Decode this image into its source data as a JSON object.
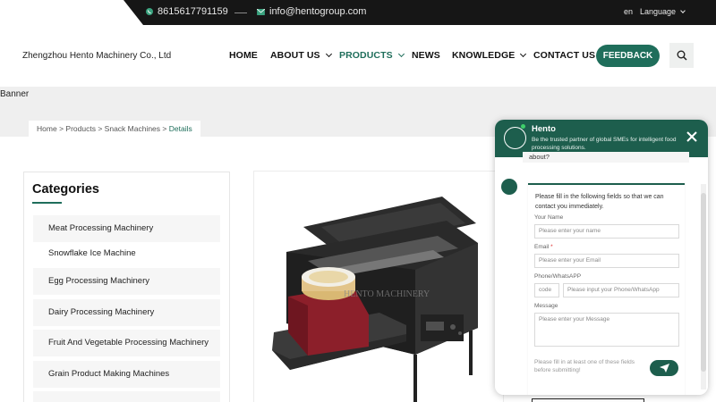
{
  "topbar": {
    "phone": "8615617791159",
    "email": "info@hentogroup.com",
    "lang_code": "en",
    "language_label": "Language"
  },
  "header": {
    "company": "Zhengzhou Hento Machinery Co., Ltd",
    "nav": {
      "home": "HOME",
      "about": "ABOUT US",
      "products": "PRODUCTS",
      "news": "NEWS",
      "knowledge": "KNOWLEDGE",
      "contact": "CONTACT US"
    },
    "feedback": "FEEDBACK"
  },
  "banner": {
    "label": "Banner"
  },
  "breadcrumb": {
    "home": "Home",
    "products": "Products",
    "snack": "Snack Machines",
    "details": "Details",
    "sep": ">"
  },
  "categories": {
    "title": "Categories",
    "items": [
      "Meat Processing Machinery",
      "Snowflake Ice Machine",
      "Egg Processing Machinery",
      "Dairy Processing Machinery",
      "Fruit And Vegetable Processing Machinery",
      "Grain Product Making Machines"
    ]
  },
  "chat": {
    "name": "Hento",
    "subtitle": "Be the trusted partner of global SMEs for intelligent food processing solutions.",
    "prev_message_tail": "about?",
    "form": {
      "intro": "Please fill in the following fields so that we can contact you immediately.",
      "name_label": "Your Name",
      "name_placeholder": "Please enter your name",
      "email_label": "Email",
      "email_required": "*",
      "email_placeholder": "Please enter your Email",
      "phone_label": "Phone/WhatsAPP",
      "code_placeholder": "code",
      "phone_placeholder": "Please input your Phone/WhatsApp",
      "message_label": "Message",
      "message_placeholder": "Please enter your Message",
      "note": "Please fill in at least one of these fields before submitting!"
    }
  },
  "colors": {
    "brand": "#1f6e5b",
    "chat_header": "#1d5e4d",
    "topbar": "#161616"
  },
  "product_image": {
    "watermark": "HENTO MACHINERY"
  }
}
